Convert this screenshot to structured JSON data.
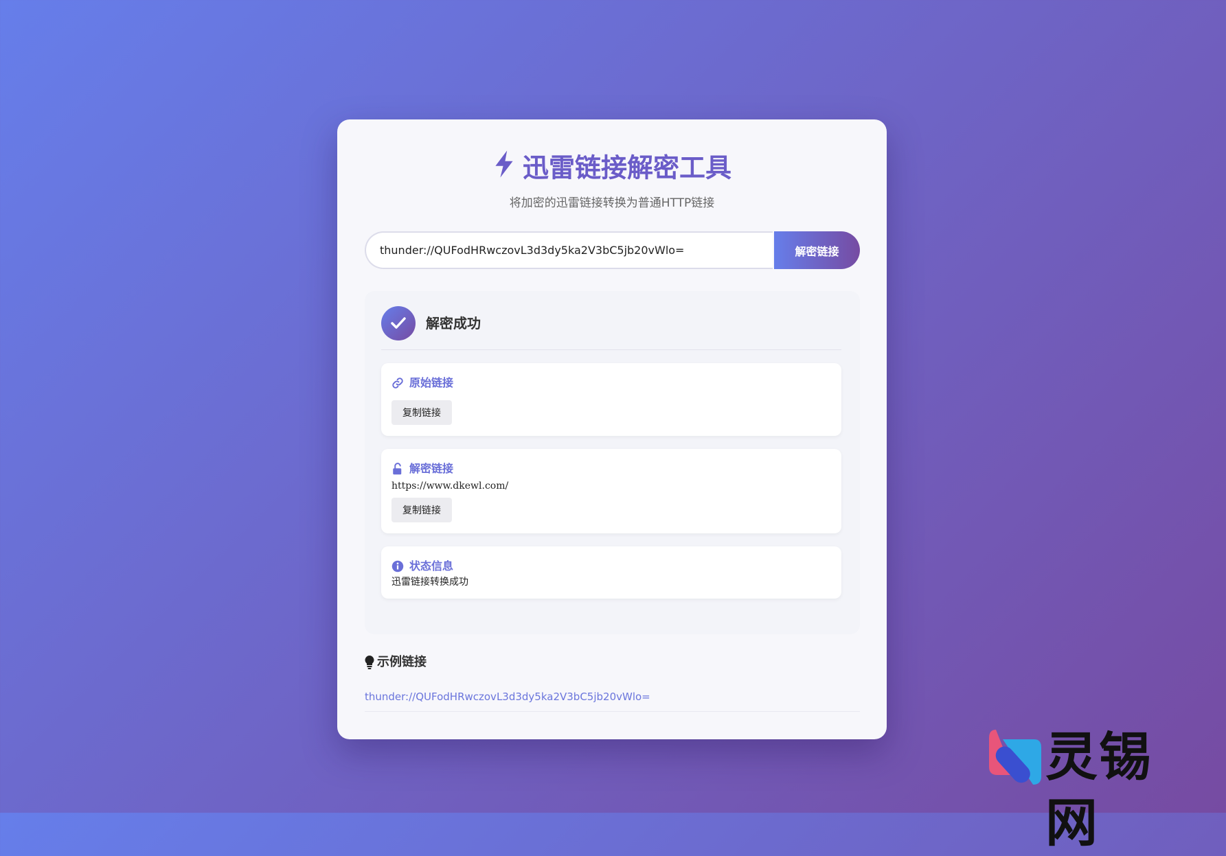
{
  "header": {
    "title": "迅雷链接解密工具",
    "subtitle": "将加密的迅雷链接转换为普通HTTP链接"
  },
  "form": {
    "input_value": "thunder://QUFodHRwczovL3d3dy5ka2V3bC5jb20vWlo=",
    "decrypt_button": "解密链接"
  },
  "result": {
    "title": "解密成功",
    "original": {
      "label": "原始链接",
      "value": "",
      "copy_button": "复制链接"
    },
    "decoded": {
      "label": "解密链接",
      "value": "https://www.dkewl.com/",
      "copy_button": "复制链接"
    },
    "status": {
      "label": "状态信息",
      "value": "迅雷链接转换成功"
    }
  },
  "examples": {
    "title": "示例链接",
    "items": [
      "thunder://QUFodHRwczovL3d3dy5ka2V3bC5jb20vWlo="
    ]
  },
  "watermark": {
    "text": "灵锡网"
  },
  "colors": {
    "gradient_start": "#667eea",
    "gradient_end": "#764ba2",
    "accent": "#6a6fd8"
  }
}
